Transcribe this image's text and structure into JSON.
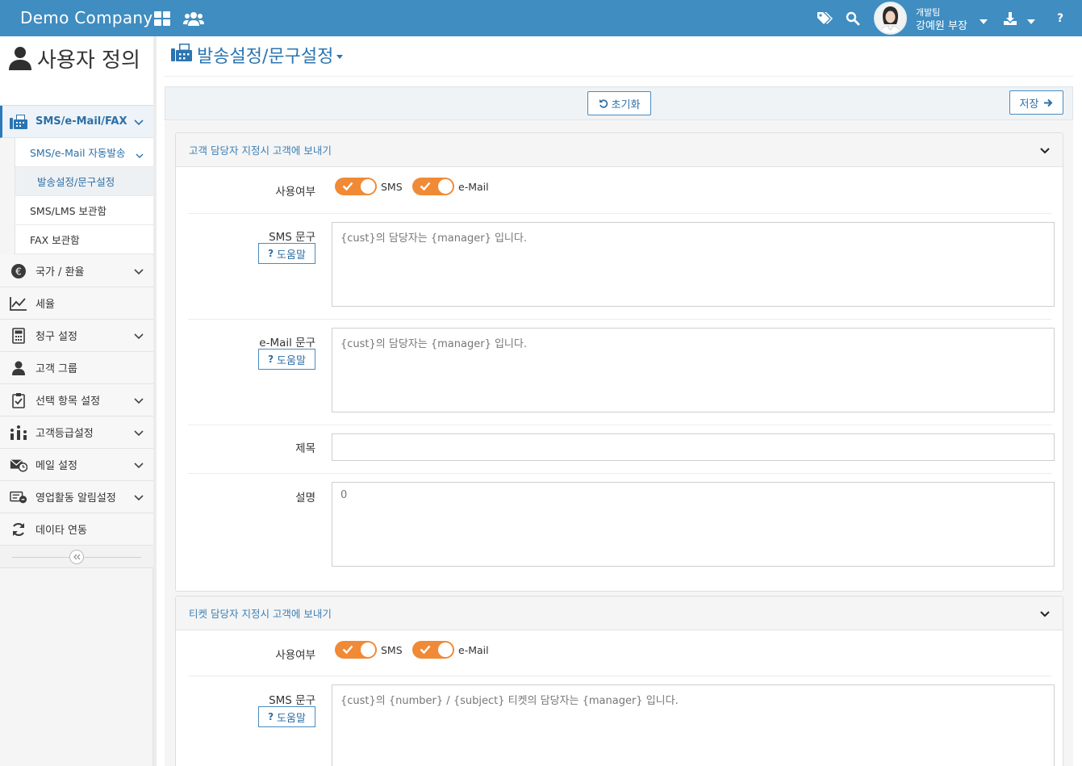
{
  "topbar": {
    "brand": "Demo Company",
    "user_team": "개발팀",
    "user_name": "강예원 부장",
    "icons": [
      "grid-icon",
      "users-icon",
      "tags-icon",
      "search-icon",
      "download-icon",
      "help-icon"
    ],
    "help_glyph": "?"
  },
  "sidebar": {
    "title": "사용자 정의",
    "menu": [
      {
        "label": "SMS/e-Mail/FAX",
        "icon": "fax-icon"
      },
      {
        "label": "국가 / 환율",
        "icon": "euro-icon"
      },
      {
        "label": "세율",
        "icon": "chart-line-icon"
      },
      {
        "label": "청구 설정",
        "icon": "calculator-icon"
      },
      {
        "label": "고객 그룹",
        "icon": "person-icon"
      },
      {
        "label": "선택 항목 설정",
        "icon": "clipboard-check-icon"
      },
      {
        "label": "고객등급설정",
        "icon": "grade-icon"
      },
      {
        "label": "메일 설정",
        "icon": "mail-clock-icon"
      },
      {
        "label": "영업활동 알림설정",
        "icon": "sales-alert-icon"
      },
      {
        "label": "데이타 연동",
        "icon": "sync-icon"
      }
    ],
    "submenu": {
      "auto_send": "SMS/e-Mail 자동발송",
      "send_settings": "발송설정/문구설정",
      "sms_lms_box": "SMS/LMS 보관함",
      "fax_box": "FAX 보관함"
    }
  },
  "main": {
    "heading": "발송설정/문구설정",
    "reset_label": "초기화",
    "save_label": "저장",
    "panel1": {
      "title": "고객 담당자 지정시 고객에 보내기",
      "use_label": "사용여부",
      "sms_toggle": "SMS",
      "email_toggle": "e-Mail",
      "sms_label": "SMS 문구",
      "help_label": "도움말",
      "sms_text": "{cust}의  담당자는  {manager} 입니다.",
      "email_label": "e-Mail 문구",
      "email_text": "{cust}의  담당자는  {manager} 입니다.",
      "subject_label": "제목",
      "subject_value": "",
      "desc_label": "설명",
      "desc_value": "0"
    },
    "panel2": {
      "title": "티켓 담당자 지정시 고객에 보내기",
      "use_label": "사용여부",
      "sms_toggle": "SMS",
      "email_toggle": "e-Mail",
      "sms_label": "SMS 문구",
      "help_label": "도움말",
      "sms_text": "{cust}의 {number} / {subject}  티켓의  담당자는  {manager} 입니다."
    }
  },
  "colors": {
    "topbar": "#3f8dc1",
    "accent": "#2b75b1",
    "toggle_on": "#f08a36"
  }
}
